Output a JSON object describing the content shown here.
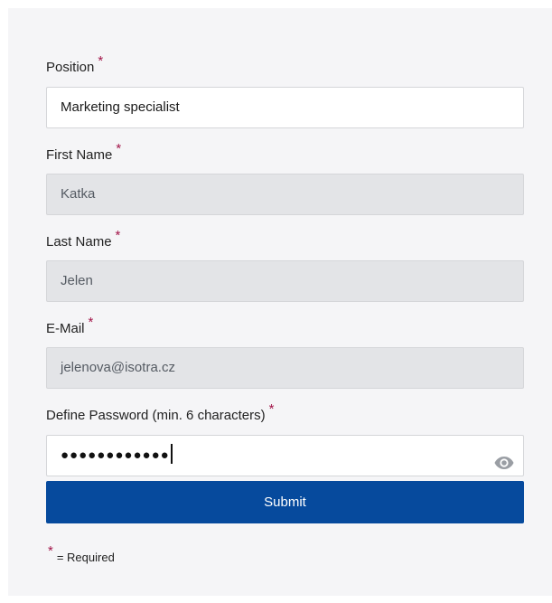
{
  "required_marker": "*",
  "form": {
    "position": {
      "label": "Position",
      "value": "Marketing specialist"
    },
    "first_name": {
      "label": "First Name",
      "value": "Katka"
    },
    "last_name": {
      "label": "Last Name",
      "value": "Jelen"
    },
    "email": {
      "label": "E-Mail",
      "value": "jelenova@isotra.cz"
    },
    "password": {
      "label": "Define Password (min. 6 characters)",
      "masked_value": "●●●●●●●●●●●●"
    },
    "submit_label": "Submit"
  },
  "footer": {
    "required_note": "= Required"
  },
  "colors": {
    "accent": "#064a9d",
    "required": "#a3164a",
    "readonly_bg": "#e3e4e7"
  },
  "icons": {
    "password_toggle": "eye-icon"
  }
}
